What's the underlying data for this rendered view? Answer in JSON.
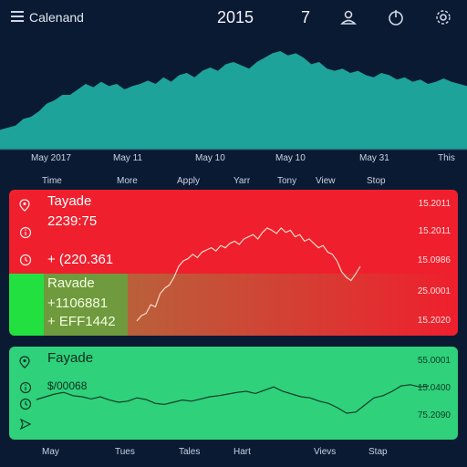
{
  "header": {
    "app_title": "Calenand",
    "year": "2015",
    "day": "7",
    "icons": [
      "menu-icon",
      "user-icon",
      "power-icon",
      "settings-icon"
    ]
  },
  "top_chart": {
    "x_labels": [
      "May 2017",
      "May 11",
      "May 10",
      "May 10",
      "May 31",
      "This"
    ],
    "filters": [
      "Time",
      "More",
      "Apply",
      "Yarr",
      "Tony",
      "View",
      "Stop"
    ],
    "color": "#1fb3a5",
    "values": [
      0.18,
      0.2,
      0.22,
      0.28,
      0.3,
      0.35,
      0.42,
      0.45,
      0.5,
      0.5,
      0.55,
      0.6,
      0.57,
      0.62,
      0.58,
      0.6,
      0.55,
      0.58,
      0.6,
      0.63,
      0.6,
      0.66,
      0.62,
      0.68,
      0.7,
      0.66,
      0.72,
      0.75,
      0.72,
      0.78,
      0.8,
      0.77,
      0.74,
      0.8,
      0.84,
      0.88,
      0.9,
      0.86,
      0.88,
      0.84,
      0.78,
      0.8,
      0.74,
      0.72,
      0.74,
      0.7,
      0.72,
      0.68,
      0.66,
      0.7,
      0.68,
      0.64,
      0.66,
      0.62,
      0.64,
      0.6,
      0.62,
      0.65,
      0.62,
      0.6,
      0.58
    ]
  },
  "red_panel": {
    "title": "Tayade",
    "value": "2239:75",
    "line2": "+ (220.361",
    "right_values": [
      "15.2011",
      "15.2011",
      "15.0986",
      "25.0001",
      "15.2020"
    ],
    "overlay_title": "Ravade",
    "overlay_line1": "+1106881",
    "overlay_line2": "+ EFF1442",
    "line_values": [
      0.05,
      0.1,
      0.12,
      0.2,
      0.18,
      0.3,
      0.35,
      0.38,
      0.45,
      0.55,
      0.6,
      0.62,
      0.66,
      0.63,
      0.68,
      0.7,
      0.72,
      0.69,
      0.74,
      0.72,
      0.76,
      0.78,
      0.75,
      0.8,
      0.82,
      0.84,
      0.8,
      0.86,
      0.9,
      0.88,
      0.85,
      0.9,
      0.86,
      0.88,
      0.82,
      0.84,
      0.78,
      0.8,
      0.76,
      0.72,
      0.74,
      0.68,
      0.66,
      0.6,
      0.5,
      0.45,
      0.42,
      0.48,
      0.55
    ]
  },
  "green_panel": {
    "title": "Fayade",
    "line1": "$/00068",
    "right_values": [
      "55.0001",
      "15.0400",
      "75.2090"
    ],
    "line_values": [
      0.45,
      0.5,
      0.55,
      0.58,
      0.52,
      0.5,
      0.46,
      0.5,
      0.44,
      0.4,
      0.42,
      0.48,
      0.45,
      0.38,
      0.36,
      0.4,
      0.44,
      0.42,
      0.46,
      0.5,
      0.52,
      0.55,
      0.58,
      0.6,
      0.56,
      0.62,
      0.68,
      0.6,
      0.55,
      0.5,
      0.48,
      0.42,
      0.38,
      0.3,
      0.2,
      0.22,
      0.35,
      0.48,
      0.52,
      0.6,
      0.7,
      0.72,
      0.68,
      0.7
    ]
  },
  "bottom_labels": [
    "May",
    "Tues",
    "Tales",
    "Hart",
    "Vievs",
    "Stap"
  ]
}
